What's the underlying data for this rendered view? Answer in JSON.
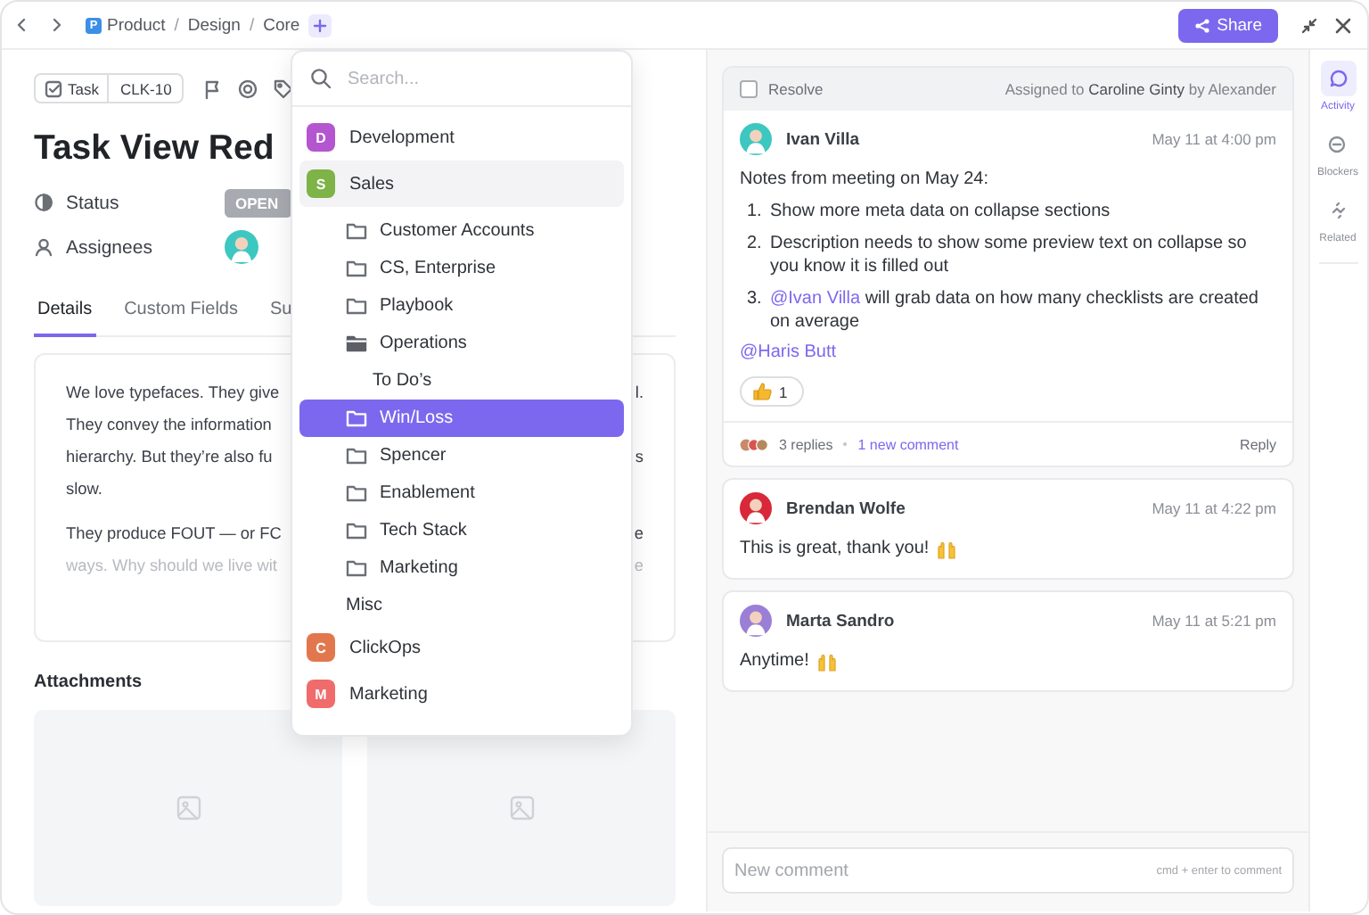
{
  "top_bar": {
    "breadcrumb": [
      {
        "kind": "crumb",
        "label": "Product",
        "badge": "P"
      },
      {
        "kind": "separator",
        "label": "/"
      },
      {
        "kind": "crumb",
        "label": "Design"
      },
      {
        "kind": "separator",
        "label": "/"
      },
      {
        "kind": "crumb",
        "label": "Core"
      }
    ],
    "share_button": "Share"
  },
  "task": {
    "type_label": "Task",
    "id": "CLK-10",
    "title": "Task View Red",
    "fields": [
      {
        "kind": "status",
        "label": "Status",
        "value": "OPEN"
      },
      {
        "kind": "assignee",
        "label": "Assignees",
        "color": "#3dc7c1"
      }
    ],
    "tabs": [
      {
        "label": "Details",
        "selected": true
      },
      {
        "label": "Custom Fields",
        "selected": false
      },
      {
        "label": "Su",
        "selected": false
      }
    ],
    "description": [
      {
        "lines": [
          {
            "text": "We love typefaces. They give",
            "end": "l.",
            "faded": false
          },
          {
            "text": "They convey the information",
            "faded": false
          },
          {
            "text": "hierarchy. But they’re also fu",
            "end": "s",
            "faded": false
          },
          {
            "text": "slow.",
            "faded": false
          }
        ]
      },
      {
        "lines": [
          {
            "text": "They produce FOUT — or FC",
            "end": "e",
            "faded": false
          },
          {
            "text": "ways. Why should we live wit",
            "end": "e",
            "faded": true
          }
        ]
      }
    ],
    "attachments": {
      "title": "Attachments",
      "items": [
        {
          "kind": "image"
        },
        {
          "kind": "image"
        }
      ]
    }
  },
  "dropdown": {
    "placeholder": "Search...",
    "items": [
      {
        "kind": "space",
        "label": "Development",
        "badge": "D",
        "color": "#b356cf",
        "expanded": false,
        "selected": false
      },
      {
        "kind": "space",
        "label": "Sales",
        "badge": "S",
        "color": "#7db347",
        "expanded": true,
        "selected": false,
        "children": [
          {
            "kind": "folder",
            "label": "Customer Accounts",
            "expanded": false,
            "selected": false
          },
          {
            "kind": "folder",
            "label": "CS, Enterprise",
            "expanded": false,
            "selected": false
          },
          {
            "kind": "folder",
            "label": "Playbook",
            "expanded": false,
            "selected": false
          },
          {
            "kind": "folder",
            "label": "Operations",
            "expanded": true,
            "selected": false,
            "children": [
              {
                "kind": "list",
                "label": "To Do’s",
                "selected": false
              }
            ]
          },
          {
            "kind": "folder",
            "label": "Win/Loss",
            "expanded": false,
            "selected": true
          },
          {
            "kind": "folder",
            "label": "Spencer",
            "expanded": false,
            "selected": false
          },
          {
            "kind": "folder",
            "label": "Enablement",
            "expanded": false,
            "selected": false
          },
          {
            "kind": "folder",
            "label": "Tech Stack",
            "expanded": false,
            "selected": false
          },
          {
            "kind": "folder",
            "label": "Marketing",
            "expanded": false,
            "selected": false
          },
          {
            "kind": "list",
            "label": "Misc",
            "selected": false
          }
        ]
      },
      {
        "kind": "space",
        "label": "ClickOps",
        "badge": "C",
        "color": "#e2774e",
        "expanded": false,
        "selected": false
      },
      {
        "kind": "space",
        "label": "Marketing",
        "badge": "M",
        "color": "#f06b6b",
        "expanded": false,
        "selected": false
      }
    ]
  },
  "activity": {
    "thread": {
      "resolve_label": "Resolve",
      "resolved": false,
      "assignment": "Assigned to **Caroline Ginty** by Alexander",
      "comment": {
        "author": "Ivan Villa",
        "time": "May 11 at 4:00 pm",
        "color": "#3dc7c1",
        "body": [
          {
            "kind": "paragraph",
            "text": "Notes from meeting on May 24:"
          },
          {
            "kind": "numbered",
            "items": [
              {
                "number": "1.",
                "text": "Show more meta data on collapse sections"
              },
              {
                "number": "2.",
                "text": "Description needs to show some preview text on collapse so you know it is filled out"
              },
              {
                "number": "3.",
                "mention": "@Ivan Villa",
                "text": " will grab data on how many checklists are created on average"
              }
            ]
          },
          {
            "kind": "mention",
            "text": "@Haris Butt"
          }
        ],
        "reactions": [
          {
            "kind": "thumbs_up",
            "count": "1"
          }
        ]
      },
      "replies": "3 replies",
      "new_comments": "1 new comment",
      "reply_button": "Reply"
    },
    "comments": [
      {
        "author": "Brendan Wolfe",
        "time": "May 11 at 4:22 pm",
        "color": "#d8283a",
        "text": "This is great, thank you!",
        "kind": "emoji_reply"
      },
      {
        "author": "Marta Sandro",
        "time": "May 11 at 5:21 pm",
        "color": "#9b7fd6",
        "text": "Anytime!",
        "kind": "emoji_reply"
      }
    ],
    "composer": {
      "placeholder": "New comment",
      "hint": "cmd + enter to comment"
    }
  },
  "rail": [
    {
      "kind": "activity",
      "label": "Activity",
      "selected": true
    },
    {
      "kind": "blockers",
      "label": "Blockers",
      "selected": false
    },
    {
      "kind": "related",
      "label": "Related",
      "selected": false
    }
  ]
}
